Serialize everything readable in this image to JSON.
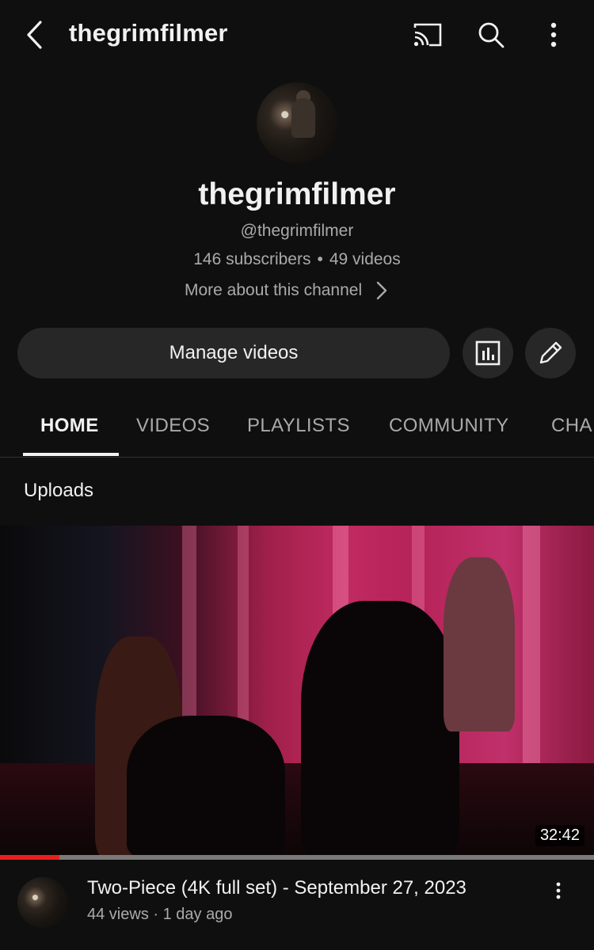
{
  "header": {
    "title": "thegrimfilmer",
    "icons": [
      "back-icon",
      "cast-icon",
      "search-icon",
      "more-vert-icon"
    ]
  },
  "channel": {
    "name": "thegrimfilmer",
    "handle": "@thegrimfilmer",
    "subscribers": "146 subscribers",
    "separator": "•",
    "videos": "49 videos",
    "more_about": "More about this channel"
  },
  "actions": {
    "manage_label": "Manage videos",
    "icons": [
      "analytics-icon",
      "edit-pencil-icon"
    ]
  },
  "tabs": [
    {
      "label": "HOME",
      "active": true
    },
    {
      "label": "VIDEOS",
      "active": false
    },
    {
      "label": "PLAYLISTS",
      "active": false
    },
    {
      "label": "COMMUNITY",
      "active": false
    },
    {
      "label": "CHA",
      "active": false
    }
  ],
  "uploads": {
    "section_title": "Uploads",
    "video": {
      "title": "Two-Piece (4K full set) - September 27, 2023",
      "views": "44 views",
      "meta_separator": "·",
      "age": "1 day ago",
      "duration": "32:42",
      "watched_fraction": 0.1
    }
  },
  "colors": {
    "background": "#0f0f0f",
    "button_bg": "#272727",
    "secondary_text": "#aaaaaa",
    "progress_red": "#e8201e"
  }
}
